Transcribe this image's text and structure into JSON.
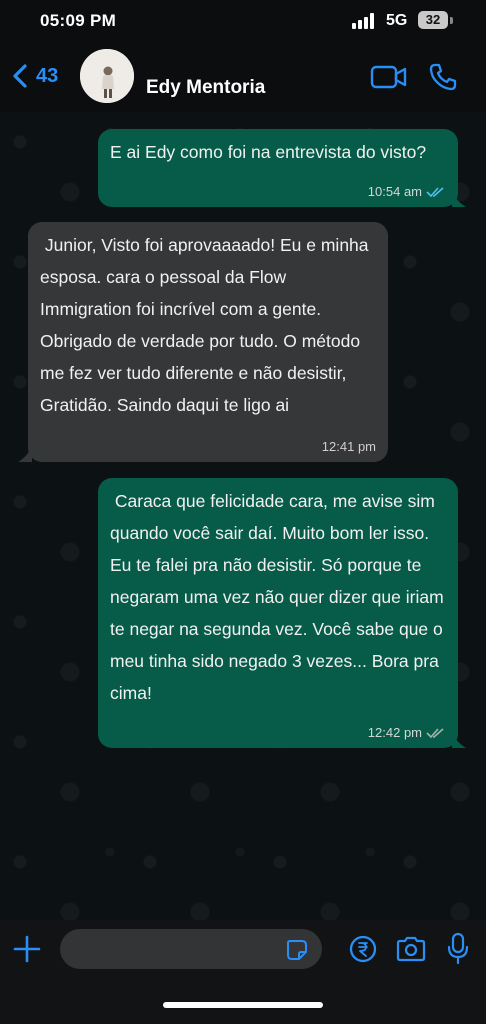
{
  "status_bar": {
    "time": "05:09 PM",
    "network": "5G",
    "battery": "32"
  },
  "header": {
    "back_count": "43",
    "contact_name": "Edy Mentoria",
    "icons": [
      "chevron-left-icon",
      "video-call-icon",
      "phone-call-icon"
    ]
  },
  "messages": [
    {
      "direction": "outgoing",
      "text": "E ai Edy como foi na entrevista do visto?",
      "time": "10:54 am",
      "status": "read"
    },
    {
      "direction": "incoming",
      "text": " Junior, Visto foi aprovaaaado! Eu e minha esposa. cara o pessoal da Flow Immigration foi incrível com a gente. Obrigado de verdade por tudo. O método me fez ver tudo diferente e não desistir, Gratidão. Saindo daqui te ligo ai",
      "time": "12:41 pm"
    },
    {
      "direction": "outgoing",
      "text": " Caraca que felicidade cara, me avise sim quando você sair daí. Muito bom ler isso. Eu te falei pra não desistir. Só porque te negaram uma vez não quer dizer que iriam te negar na segunda vez. Você sabe que o meu tinha sido negado 3 vezes... Bora pra cima!",
      "time": "12:42 pm",
      "status": "delivered"
    }
  ],
  "composer": {
    "placeholder": "",
    "icons": [
      "plus-icon",
      "sticker-icon",
      "payment-icon",
      "camera-icon",
      "microphone-icon"
    ]
  },
  "colors": {
    "accent": "#2a8ef5",
    "outgoing_bubble": "#075c49",
    "incoming_bubble": "#363738",
    "read_ticks": "#53bdeb"
  }
}
